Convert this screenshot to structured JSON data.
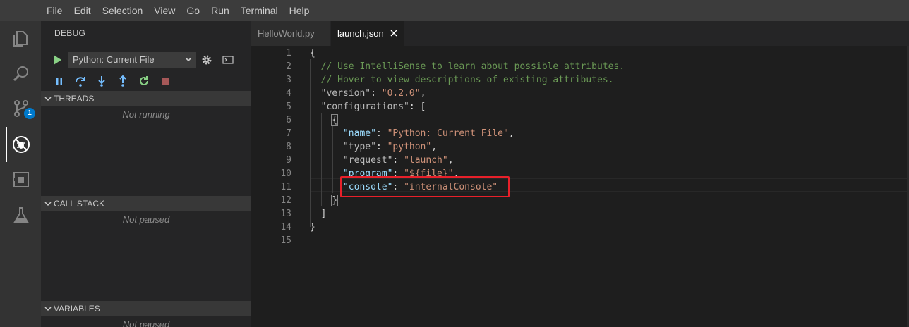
{
  "menu": [
    "File",
    "Edit",
    "Selection",
    "View",
    "Go",
    "Run",
    "Terminal",
    "Help"
  ],
  "activity": {
    "icons": [
      "explorer-icon",
      "search-icon",
      "source-control-icon",
      "debug-icon",
      "extensions-icon",
      "test-flask-icon"
    ],
    "scm_badge": "1",
    "active": "debug-icon"
  },
  "sidebar": {
    "title": "DEBUG",
    "config_selected": "Python: Current File",
    "sections": {
      "threads": {
        "title": "THREADS",
        "empty": "Not running"
      },
      "call_stack": {
        "title": "CALL STACK",
        "empty": "Not paused"
      },
      "variables": {
        "title": "VARIABLES",
        "empty": "Not paused"
      }
    },
    "toolbar": [
      "pause-icon",
      "step-over-icon",
      "step-into-icon",
      "step-out-icon",
      "restart-icon",
      "stop-icon"
    ]
  },
  "tabs": [
    {
      "label": "HelloWorld.py",
      "active": false
    },
    {
      "label": "launch.json",
      "active": true
    }
  ],
  "editor": {
    "line_numbers": [
      "1",
      "2",
      "3",
      "4",
      "5",
      "6",
      "7",
      "8",
      "9",
      "10",
      "11",
      "12",
      "13",
      "14",
      "15"
    ],
    "lines": [
      "{",
      "  // Use IntelliSense to learn about possible attributes.",
      "  // Hover to view descriptions of existing attributes.",
      "  \"version\": \"0.2.0\",",
      "  \"configurations\": [",
      "    {",
      "      \"name\": \"Python: Current File\",",
      "      \"type\": \"python\",",
      "      \"request\": \"launch\",",
      "      \"program\": \"${file}\",",
      "      \"console\": \"internalConsole\"",
      "    }",
      "  ]",
      "}",
      ""
    ],
    "highlighted_line": "11"
  },
  "colors": {
    "accent": "#007acc",
    "highlight_box": "#e8202a",
    "run_green": "#89d185"
  }
}
